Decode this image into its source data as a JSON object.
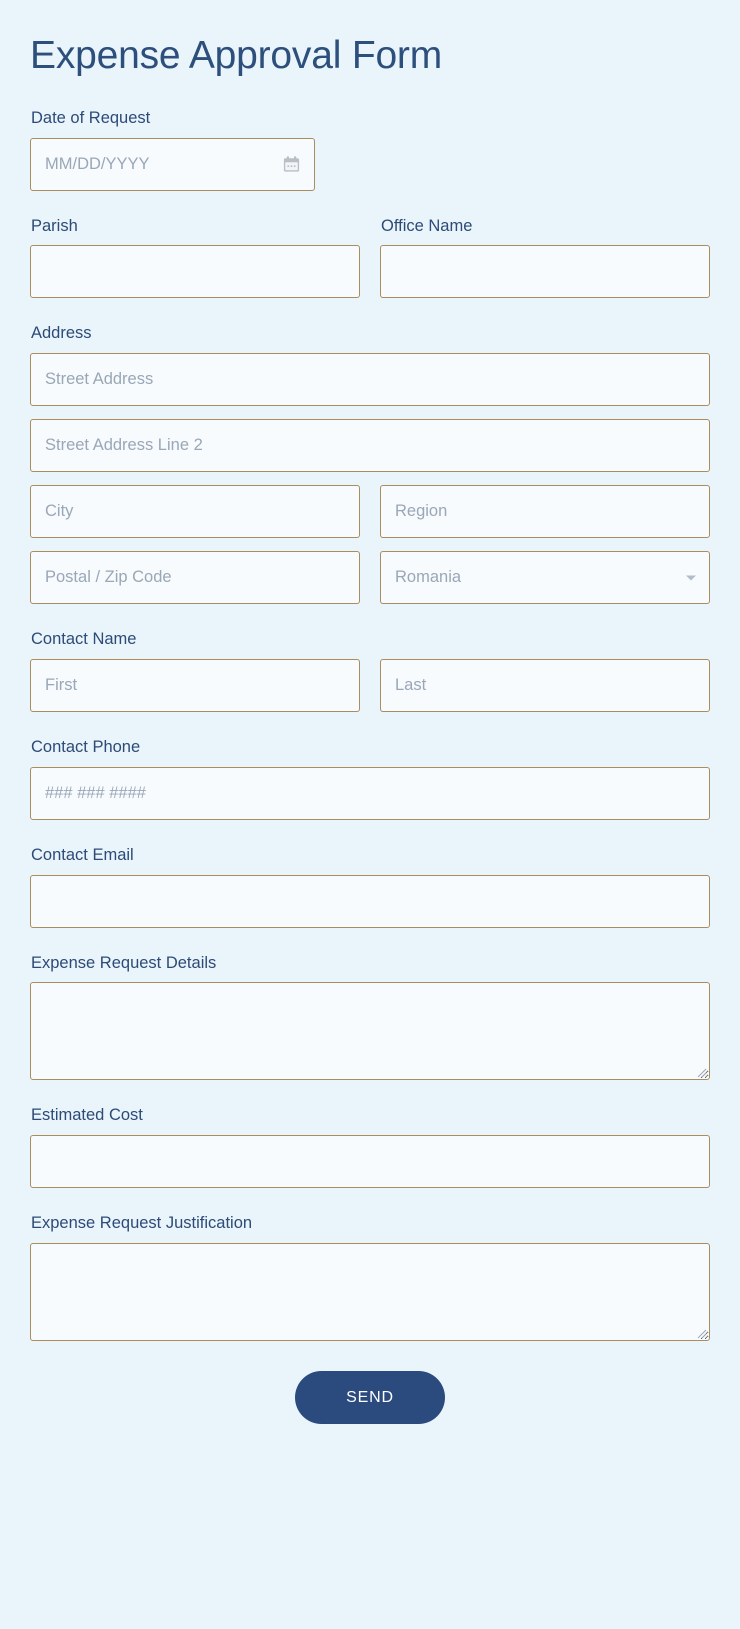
{
  "form": {
    "title": "Expense Approval Form",
    "fields": {
      "date_of_request": {
        "label": "Date of Request",
        "placeholder": "MM/DD/YYYY",
        "value": "",
        "icon": "calendar-icon"
      },
      "parish": {
        "label": "Parish",
        "placeholder": "",
        "value": ""
      },
      "office_name": {
        "label": "Office Name",
        "placeholder": "",
        "value": ""
      },
      "address": {
        "label": "Address",
        "street1": {
          "placeholder": "Street Address",
          "value": ""
        },
        "street2": {
          "placeholder": "Street Address Line 2",
          "value": ""
        },
        "city": {
          "placeholder": "City",
          "value": ""
        },
        "region": {
          "placeholder": "Region",
          "value": ""
        },
        "postal": {
          "placeholder": "Postal / Zip Code",
          "value": ""
        },
        "country": {
          "selected": "Romania",
          "icon": "chevron-down-icon"
        }
      },
      "contact_name": {
        "label": "Contact Name",
        "first": {
          "placeholder": "First",
          "value": ""
        },
        "last": {
          "placeholder": "Last",
          "value": ""
        }
      },
      "contact_phone": {
        "label": "Contact Phone",
        "placeholder": "### ### ####",
        "value": ""
      },
      "contact_email": {
        "label": "Contact Email",
        "placeholder": "",
        "value": ""
      },
      "expense_request_details": {
        "label": "Expense Request Details",
        "placeholder": "",
        "value": ""
      },
      "estimated_cost": {
        "label": "Estimated Cost",
        "placeholder": "",
        "value": ""
      },
      "expense_request_justification": {
        "label": "Expense Request Justification",
        "placeholder": "",
        "value": ""
      }
    },
    "submit": {
      "label": "SEND"
    },
    "colors": {
      "background": "#eaf4fb",
      "label_text": "#2c4b77",
      "title_text": "#2d4f7c",
      "input_background": "#f7fbfe",
      "input_border": "#a98d5f",
      "placeholder_text": "#9aa7b6",
      "button_background": "#2b4a7d",
      "button_text": "#ffffff"
    }
  }
}
